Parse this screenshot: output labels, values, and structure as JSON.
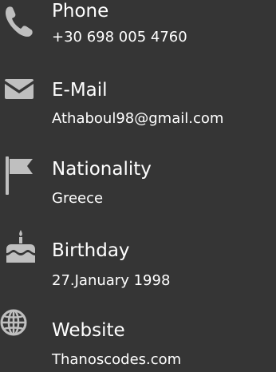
{
  "contact": {
    "phone": {
      "icon": "phone-icon",
      "label": "Phone",
      "value": "+30 698 005 4760"
    },
    "email": {
      "icon": "envelope-icon",
      "label": "E-Mail",
      "value": "Athaboul98@gmail.com"
    },
    "nationality": {
      "icon": "flag-icon",
      "label": "Nationality",
      "value": "Greece"
    },
    "birthday": {
      "icon": "birthday-cake-icon",
      "label": "Birthday",
      "value": "27.January 1998"
    },
    "website": {
      "icon": "globe-icon",
      "label": "Website",
      "value": "Thanoscodes.com"
    }
  },
  "colors": {
    "background": "#353535",
    "icon": "#bfbfbf",
    "text": "#ffffff"
  }
}
